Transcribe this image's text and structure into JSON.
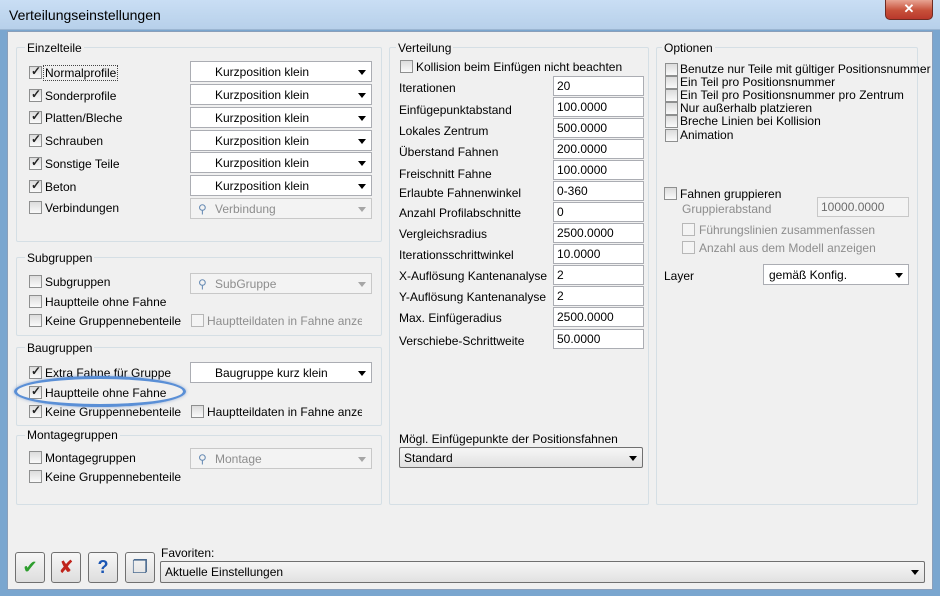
{
  "window": {
    "title": "Verteilungseinstellungen",
    "close_glyph": "✕"
  },
  "einzelteile": {
    "legend": "Einzelteile",
    "rows": [
      {
        "label": "Normalprofile",
        "checked": true,
        "combo": "Kurzposition klein",
        "enabled": true
      },
      {
        "label": "Sonderprofile",
        "checked": true,
        "combo": "Kurzposition klein",
        "enabled": true
      },
      {
        "label": "Platten/Bleche",
        "checked": true,
        "combo": "Kurzposition klein",
        "enabled": true
      },
      {
        "label": "Schrauben",
        "checked": true,
        "combo": "Kurzposition klein",
        "enabled": true
      },
      {
        "label": "Sonstige Teile",
        "checked": true,
        "combo": "Kurzposition klein",
        "enabled": true
      },
      {
        "label": "Beton",
        "checked": true,
        "combo": "Kurzposition klein",
        "enabled": true
      },
      {
        "label": "Verbindungen",
        "checked": false,
        "combo": "Verbindung",
        "enabled": false
      }
    ]
  },
  "subgruppen": {
    "legend": "Subgruppen",
    "subgruppen_label": "Subgruppen",
    "subgruppen_combo": "SubGruppe",
    "hauptteile_label": "Hauptteile ohne Fahne",
    "keine_label": "Keine Gruppennebenteile",
    "hauptteildaten_label": "Hauptteildaten in Fahne anzeigen"
  },
  "baugruppen": {
    "legend": "Baugruppen",
    "extra_label": "Extra Fahne für Gruppe",
    "extra_combo": "Baugruppe kurz klein",
    "hauptteile_label": "Hauptteile ohne Fahne",
    "keine_label": "Keine Gruppennebenteile",
    "hauptteildaten_label": "Hauptteildaten in Fahne anzeigen"
  },
  "montagegruppen": {
    "legend": "Montagegruppen",
    "montage_label": "Montagegruppen",
    "montage_combo": "Montage",
    "keine_label": "Keine Gruppennebenteile"
  },
  "verteilung": {
    "legend": "Verteilung",
    "kollision_label": "Kollision beim Einfügen nicht beachten",
    "fields": [
      {
        "label": "Iterationen",
        "value": "20"
      },
      {
        "label": "Einfügepunktabstand",
        "value": "100.0000"
      },
      {
        "label": "Lokales Zentrum",
        "value": "500.0000"
      },
      {
        "label": "Überstand Fahnen",
        "value": "200.0000"
      },
      {
        "label": "Freischnitt Fahne",
        "value": "100.0000"
      },
      {
        "label": "Erlaubte Fahnenwinkel",
        "value": "0-360"
      },
      {
        "label": "Anzahl Profilabschnitte",
        "value": "0"
      },
      {
        "label": "Vergleichsradius",
        "value": "2500.0000"
      },
      {
        "label": "Iterationsschrittwinkel",
        "value": "10.0000"
      },
      {
        "label": "X-Auflösung Kantenanalyse",
        "value": "2"
      },
      {
        "label": "Y-Auflösung Kantenanalyse",
        "value": "2"
      },
      {
        "label": "Max. Einfügeradius",
        "value": "2500.0000"
      },
      {
        "label": "Verschiebe-Schrittweite",
        "value": "50.0000"
      }
    ],
    "einfuegepunkte_label": "Mögl. Einfügepunkte der Positionsfahnen",
    "einfuegepunkte_value": "Standard"
  },
  "optionen": {
    "legend": "Optionen",
    "items": [
      "Benutze nur Teile mit gültiger Positionsnummer",
      "Ein Teil pro Positionsnummer",
      "Ein Teil pro Positionsnummer pro Zentrum",
      "Nur außerhalb platzieren",
      "Breche Linien bei Kollision",
      "Animation"
    ],
    "fahnen_gruppieren": "Fahnen gruppieren",
    "gruppierabstand_label": "Gruppierabstand",
    "gruppierabstand_value": "10000.0000",
    "fuehrungslinien": "Führungslinien zusammenfassen",
    "anzahl_modell": "Anzahl aus dem Modell anzeigen",
    "layer_label": "Layer",
    "layer_value": "gemäß Konfig."
  },
  "footer": {
    "favoriten_label": "Favoriten:",
    "favoriten_value": "Aktuelle Einstellungen",
    "ok_glyph": "✔",
    "cancel_glyph": "✘",
    "help_glyph": "?",
    "copy_glyph": "❐"
  },
  "colors": {
    "ok": "#2e9e2e",
    "cancel": "#c0241b",
    "help": "#1b56b4",
    "highlight": "#5a8fd6"
  }
}
